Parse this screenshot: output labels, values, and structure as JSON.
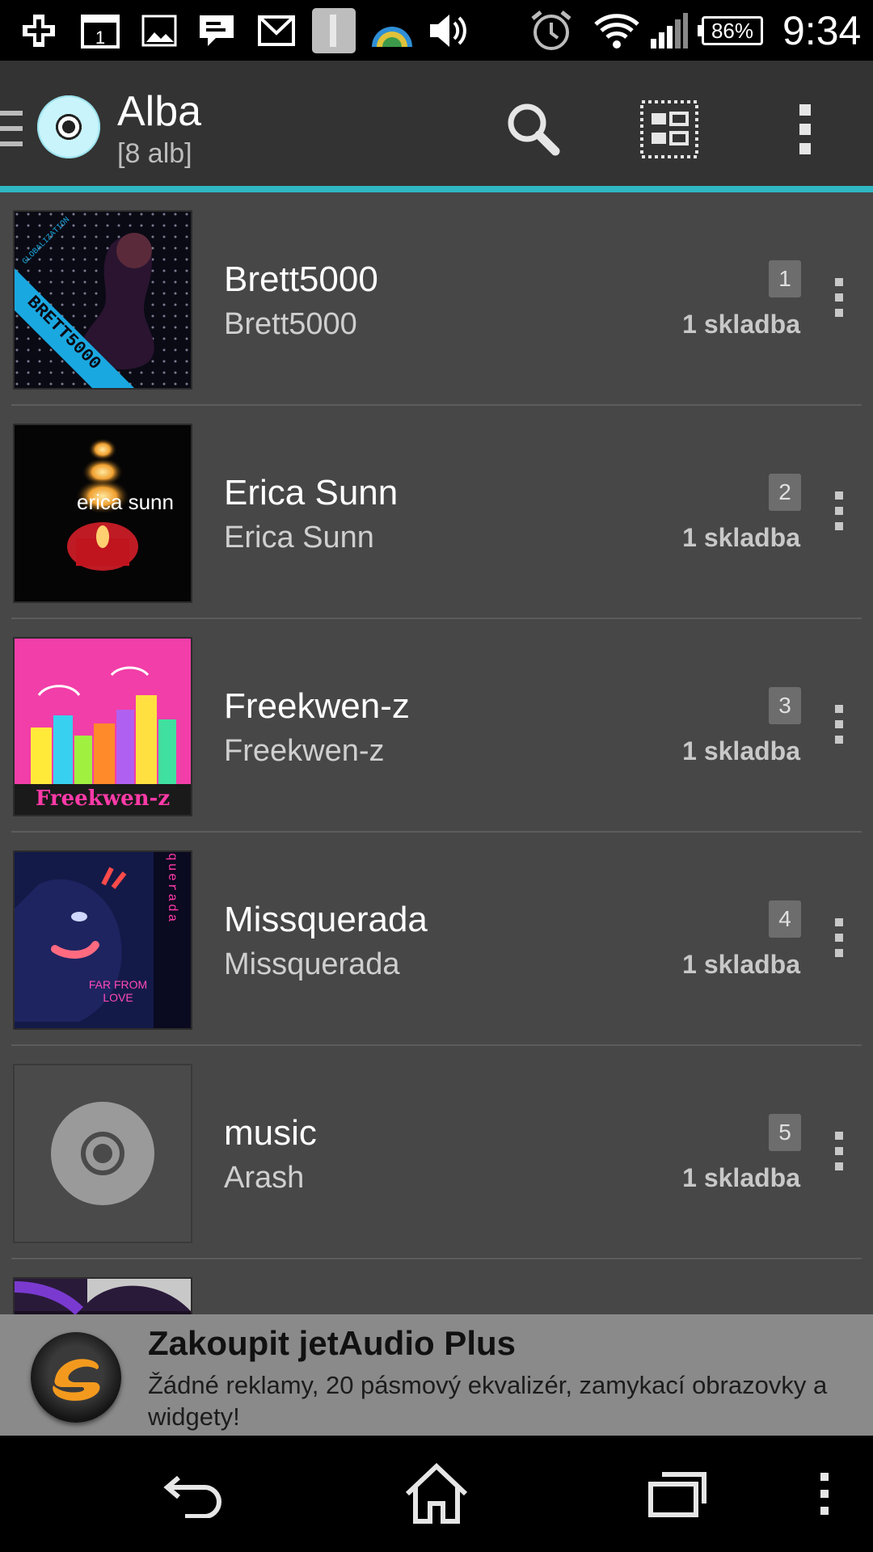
{
  "status_bar": {
    "battery": "86%",
    "time": "9:34"
  },
  "header": {
    "title": "Alba",
    "subtitle": "[8 alb]",
    "accent_color": "#2fb7c4"
  },
  "albums": [
    {
      "title": "Brett5000",
      "artist": "Brett5000",
      "number": "1",
      "count": "1 skladba",
      "art_text": "BRETT5000",
      "art_caption": "GLOBALIZATION"
    },
    {
      "title": "Erica Sunn",
      "artist": "Erica Sunn",
      "number": "2",
      "count": "1 skladba",
      "art_text": "erica sunn"
    },
    {
      "title": "Freekwen-z",
      "artist": "Freekwen-z",
      "number": "3",
      "count": "1 skladba",
      "art_text": "Freekwen-z"
    },
    {
      "title": "Missquerada",
      "artist": "Missquerada",
      "number": "4",
      "count": "1 skladba",
      "art_text": "missquerada",
      "art_caption": "FAR FROM LOVE"
    },
    {
      "title": "music",
      "artist": "Arash",
      "number": "5",
      "count": "1 skladba"
    }
  ],
  "ad": {
    "title": "Zakoupit jetAudio Plus",
    "text": "Žádné reklamy, 20 pásmový ekvalizér, zamykací obrazovky a widgety!"
  }
}
